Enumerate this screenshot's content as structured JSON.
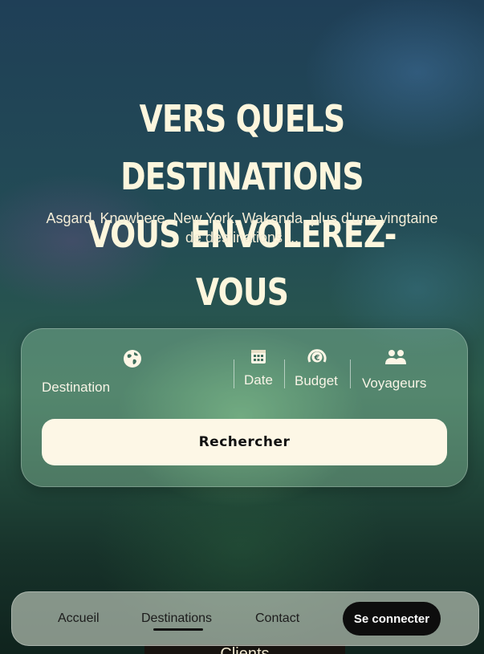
{
  "hero": {
    "title_line1": "Vers quels destinations",
    "title_line2": "vous envolerez-vous",
    "subtitle_line1": "Asgard, Knowhere, New York, Wakanda, plus d'une vingtaine",
    "subtitle_line2": "de destinations ..."
  },
  "search": {
    "destination_label": "Destination",
    "destination_icon": "globe-icon",
    "date_label": "Date",
    "date_icon": "calendar-icon",
    "budget_label": "Budget",
    "budget_icon": "euro-coin-icon",
    "travelers_label": "Voyageurs",
    "travelers_icon": "people-icon",
    "button_label": "Rechercher"
  },
  "nav": {
    "items": [
      "Accueil",
      "Destinations",
      "Contact"
    ],
    "active": "Destinations",
    "login_label": "Se connecter"
  },
  "below_fold": {
    "section_title": "Clients"
  }
}
